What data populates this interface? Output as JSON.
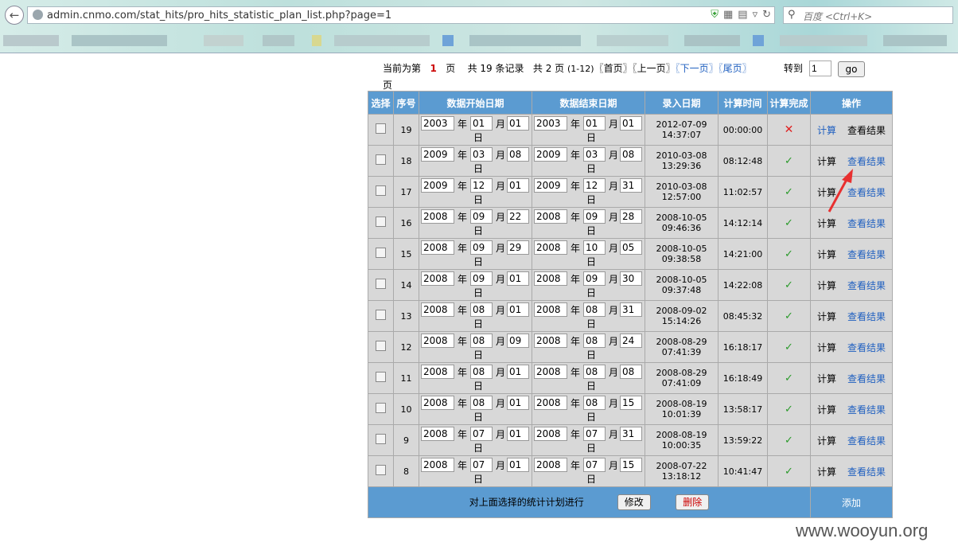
{
  "browser": {
    "url": "admin.cnmo.com/stat_hits/pro_hits_statistic_plan_list.php?page=1",
    "search_placeholder": "百度 <Ctrl+K>"
  },
  "pager": {
    "prefix": "当前为第",
    "current_page": "1",
    "page_word": "页",
    "total_records": "共 19 条记录",
    "total_pages": "共 2 页",
    "range": "(1-12)",
    "first": "〖首页〗",
    "prev": "〖上一页〗",
    "next": "〖下一页〗",
    "last": "〖尾页〗",
    "jump_label": "转到",
    "jump_value": "1",
    "go_label": "go",
    "page_suffix": "页"
  },
  "table": {
    "headers": [
      "选择",
      "序号",
      "数据开始日期",
      "数据结束日期",
      "录入日期",
      "计算时间",
      "计算完成",
      "操作"
    ],
    "date_units": {
      "year": "年",
      "month": "月",
      "day": "日"
    },
    "calc_label": "计算",
    "result_label": "查看结果",
    "rows": [
      {
        "id": "19",
        "start": {
          "y": "2003",
          "m": "01",
          "d": "01"
        },
        "end": {
          "y": "2003",
          "m": "01",
          "d": "01"
        },
        "entered": [
          "2012-07-09",
          "14:37:07"
        ],
        "calc_time": "00:00:00",
        "done": false,
        "result_link": false
      },
      {
        "id": "18",
        "start": {
          "y": "2009",
          "m": "03",
          "d": "08"
        },
        "end": {
          "y": "2009",
          "m": "03",
          "d": "08"
        },
        "entered": [
          "2010-03-08",
          "13:29:36"
        ],
        "calc_time": "08:12:48",
        "done": true,
        "result_link": true
      },
      {
        "id": "17",
        "start": {
          "y": "2009",
          "m": "12",
          "d": "01"
        },
        "end": {
          "y": "2009",
          "m": "12",
          "d": "31"
        },
        "entered": [
          "2010-03-08",
          "12:57:00"
        ],
        "calc_time": "11:02:57",
        "done": true,
        "result_link": true
      },
      {
        "id": "16",
        "start": {
          "y": "2008",
          "m": "09",
          "d": "22"
        },
        "end": {
          "y": "2008",
          "m": "09",
          "d": "28"
        },
        "entered": [
          "2008-10-05",
          "09:46:36"
        ],
        "calc_time": "14:12:14",
        "done": true,
        "result_link": true
      },
      {
        "id": "15",
        "start": {
          "y": "2008",
          "m": "09",
          "d": "29"
        },
        "end": {
          "y": "2008",
          "m": "10",
          "d": "05"
        },
        "entered": [
          "2008-10-05",
          "09:38:58"
        ],
        "calc_time": "14:21:00",
        "done": true,
        "result_link": true
      },
      {
        "id": "14",
        "start": {
          "y": "2008",
          "m": "09",
          "d": "01"
        },
        "end": {
          "y": "2008",
          "m": "09",
          "d": "30"
        },
        "entered": [
          "2008-10-05",
          "09:37:48"
        ],
        "calc_time": "14:22:08",
        "done": true,
        "result_link": true
      },
      {
        "id": "13",
        "start": {
          "y": "2008",
          "m": "08",
          "d": "01"
        },
        "end": {
          "y": "2008",
          "m": "08",
          "d": "31"
        },
        "entered": [
          "2008-09-02",
          "15:14:26"
        ],
        "calc_time": "08:45:32",
        "done": true,
        "result_link": true
      },
      {
        "id": "12",
        "start": {
          "y": "2008",
          "m": "08",
          "d": "09"
        },
        "end": {
          "y": "2008",
          "m": "08",
          "d": "24"
        },
        "entered": [
          "2008-08-29",
          "07:41:39"
        ],
        "calc_time": "16:18:17",
        "done": true,
        "result_link": true
      },
      {
        "id": "11",
        "start": {
          "y": "2008",
          "m": "08",
          "d": "01"
        },
        "end": {
          "y": "2008",
          "m": "08",
          "d": "08"
        },
        "entered": [
          "2008-08-29",
          "07:41:09"
        ],
        "calc_time": "16:18:49",
        "done": true,
        "result_link": true
      },
      {
        "id": "10",
        "start": {
          "y": "2008",
          "m": "08",
          "d": "01"
        },
        "end": {
          "y": "2008",
          "m": "08",
          "d": "15"
        },
        "entered": [
          "2008-08-19",
          "10:01:39"
        ],
        "calc_time": "13:58:17",
        "done": true,
        "result_link": true
      },
      {
        "id": "9",
        "start": {
          "y": "2008",
          "m": "07",
          "d": "01"
        },
        "end": {
          "y": "2008",
          "m": "07",
          "d": "31"
        },
        "entered": [
          "2008-08-19",
          "10:00:35"
        ],
        "calc_time": "13:59:22",
        "done": true,
        "result_link": true
      },
      {
        "id": "8",
        "start": {
          "y": "2008",
          "m": "07",
          "d": "01"
        },
        "end": {
          "y": "2008",
          "m": "07",
          "d": "15"
        },
        "entered": [
          "2008-07-22",
          "13:18:12"
        ],
        "calc_time": "10:41:47",
        "done": true,
        "result_link": true
      }
    ]
  },
  "footer": {
    "label": "对上面选择的统计计划进行",
    "edit": "修改",
    "delete": "删除",
    "add": "添加"
  },
  "watermark": "www.wooyun.org",
  "colors": {
    "header_bg": "#5b9bd1",
    "row_bg": "#d8d8d8",
    "link": "#2060c0",
    "cross": "#e02020",
    "tick": "#2a9a2a",
    "delete_text": "#cc0000"
  }
}
